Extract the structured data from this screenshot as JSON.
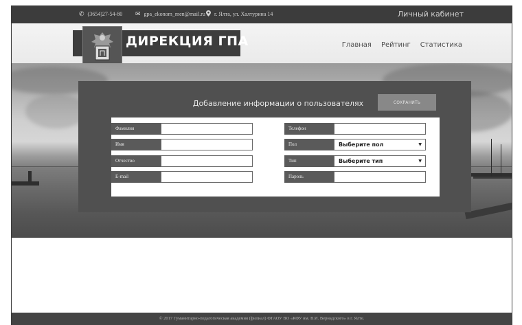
{
  "topbar": {
    "phone": "(3654)27-54-80",
    "email": "gpa_ekonom_men@mail.ru",
    "address": "г. Ялта, ул. Халтурина 14",
    "cabinet_label": "Личный кабинет"
  },
  "header": {
    "logo_text": "ДИРЕКЦИЯ ГПА",
    "nav": [
      "Главная",
      "Рейтинг",
      "Статистика"
    ]
  },
  "panel": {
    "title": "Добавление информации о пользователях",
    "save_label": "СОХРАНИТЬ",
    "left_fields": [
      {
        "label": "Фамилия",
        "value": ""
      },
      {
        "label": "Имя",
        "value": ""
      },
      {
        "label": "Отчество",
        "value": ""
      },
      {
        "label": "E-mail",
        "value": ""
      }
    ],
    "right_fields": [
      {
        "label": "Телефон",
        "value": ""
      },
      {
        "label": "Пол",
        "value": "Выберите пол"
      },
      {
        "label": "Тип",
        "value": "Выберите тип"
      },
      {
        "label": "Пароль",
        "value": ""
      }
    ]
  },
  "footer": {
    "text": "© 2017 Гуманитарно-педагогическая академия (филиал) ФГАОУ ВО «КФУ им. В.И. Вернадского» в г. Ялте."
  },
  "colors": {
    "topbar": "#3c3c3c",
    "panel": "#505050",
    "footer": "#444444",
    "field_label": "#5a5a5a",
    "save_button": "#888888"
  }
}
